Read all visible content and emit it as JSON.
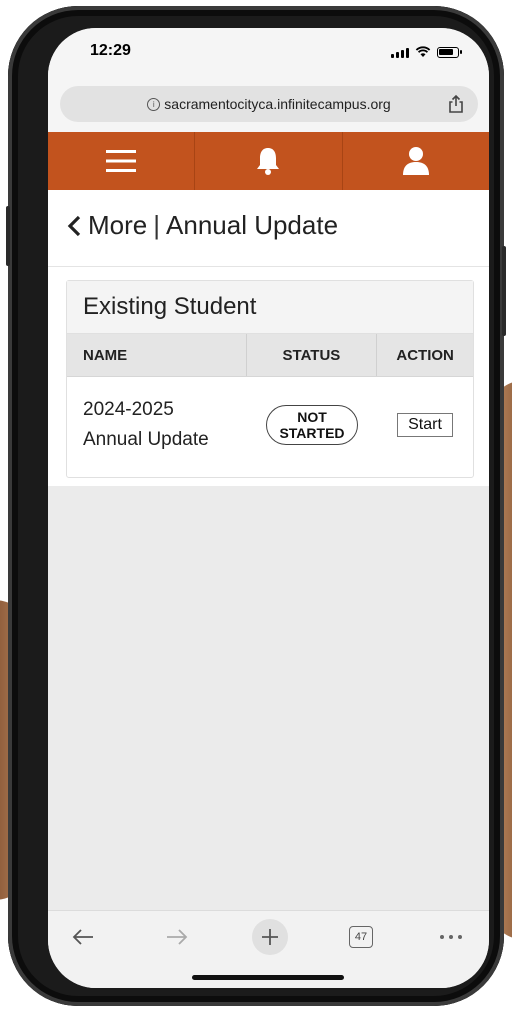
{
  "status_bar": {
    "time": "12:29"
  },
  "browser": {
    "url": "sacramentocityca.infinitecampus.org",
    "tab_count": "47"
  },
  "nav": {
    "menu": "menu-icon",
    "notifications": "bell-icon",
    "profile": "user-icon"
  },
  "page": {
    "back_label": "More",
    "title": "Annual Update"
  },
  "card": {
    "title": "Existing Student",
    "columns": [
      "NAME",
      "STATUS",
      "ACTION"
    ],
    "rows": [
      {
        "name_line1": "2024-2025",
        "name_line2": "Annual Update",
        "status_line1": "NOT",
        "status_line2": "STARTED",
        "action": "Start"
      }
    ]
  },
  "colors": {
    "accent": "#c2531e",
    "background": "#ebebeb"
  }
}
